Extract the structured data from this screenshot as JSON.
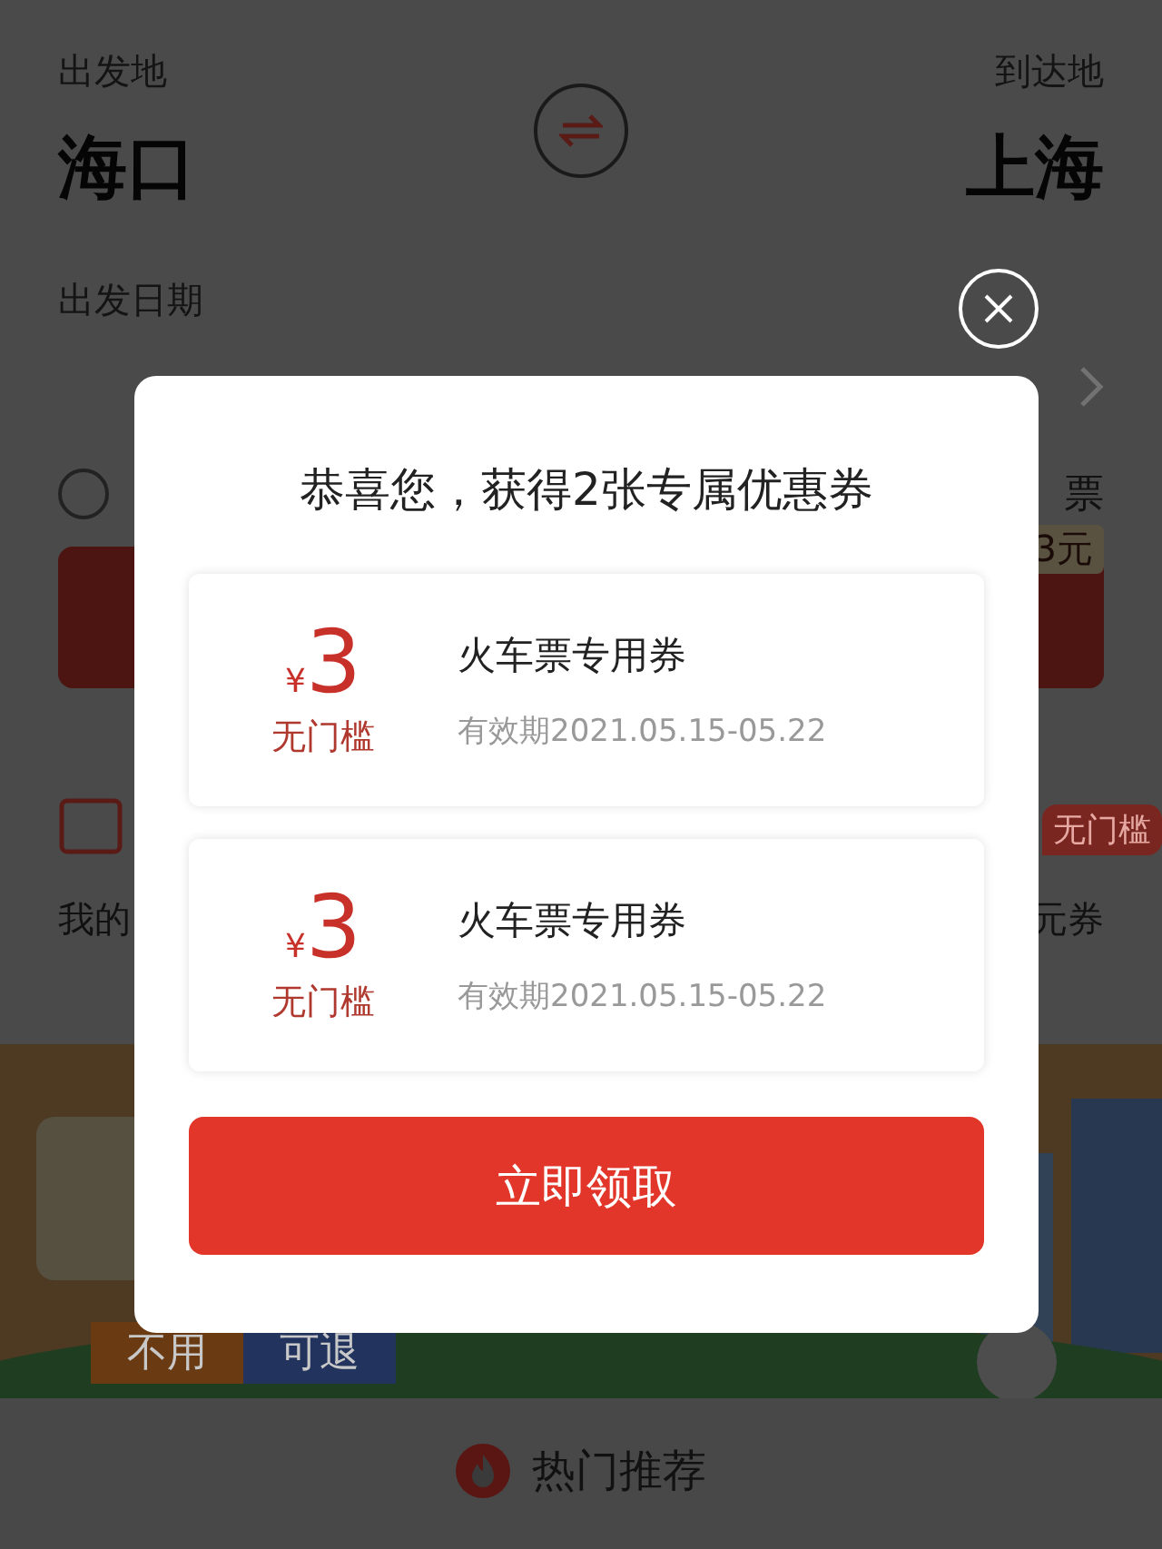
{
  "route": {
    "origin_label": "出发地",
    "origin": "海口",
    "destination_label": "到达地",
    "destination": "上海"
  },
  "date": {
    "label": "出发日期"
  },
  "options": {
    "radio_checked": false,
    "right_label": "票"
  },
  "search_button": {
    "tag": "3元"
  },
  "entries": {
    "badge": "无门槛",
    "left_label": "我的",
    "right_label": "元券"
  },
  "banner": {
    "kind": "picture",
    "tags": [
      "不用",
      "可退"
    ]
  },
  "section": {
    "title": "热门推荐"
  },
  "modal": {
    "title": "恭喜您，获得2张专属优惠券",
    "coupons": [
      {
        "currency": "¥",
        "amount": "3",
        "condition": "无门槛",
        "name": "火车票专用券",
        "validity": "有效期2021.05.15-05.22"
      },
      {
        "currency": "¥",
        "amount": "3",
        "condition": "无门槛",
        "name": "火车票专用券",
        "validity": "有效期2021.05.15-05.22"
      }
    ],
    "button": "立即领取"
  }
}
